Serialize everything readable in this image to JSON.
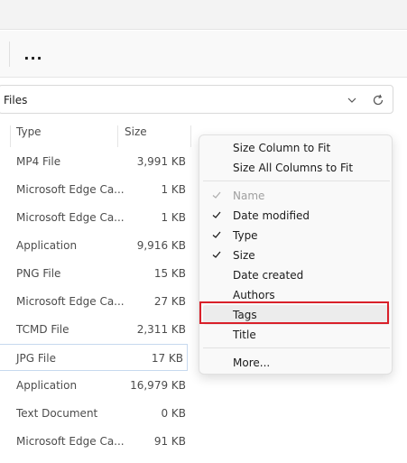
{
  "toolbar": {
    "more_label": "..."
  },
  "address": {
    "text": "Files"
  },
  "columns": {
    "type": "Type",
    "size": "Size"
  },
  "rows": [
    {
      "type": "MP4 File",
      "size": "3,991 KB"
    },
    {
      "type": "Microsoft Edge Ca...",
      "size": "1 KB"
    },
    {
      "type": "Microsoft Edge Ca...",
      "size": "1 KB"
    },
    {
      "type": "Application",
      "size": "9,916 KB"
    },
    {
      "type": "PNG File",
      "size": "15 KB"
    },
    {
      "type": "Microsoft Edge Ca...",
      "size": "27 KB"
    },
    {
      "type": "TCMD File",
      "size": "2,311 KB"
    },
    {
      "type": "JPG File",
      "size": "17 KB"
    },
    {
      "type": "Application",
      "size": "16,979 KB"
    },
    {
      "type": "Text Document",
      "size": "0 KB"
    },
    {
      "type": "Microsoft Edge Ca...",
      "size": "91 KB"
    }
  ],
  "menu": {
    "size_column": "Size Column to Fit",
    "size_all": "Size All Columns to Fit",
    "name": "Name",
    "date_modified": "Date modified",
    "type": "Type",
    "size": "Size",
    "date_created": "Date created",
    "authors": "Authors",
    "tags": "Tags",
    "title": "Title",
    "more": "More..."
  },
  "icons": {
    "more": "more-horizontal-icon",
    "chevron": "chevron-down-icon",
    "refresh": "refresh-icon",
    "check": "checkmark-icon"
  },
  "colors": {
    "highlight_border": "#d9202a",
    "selected_border": "#c7d9ee"
  }
}
